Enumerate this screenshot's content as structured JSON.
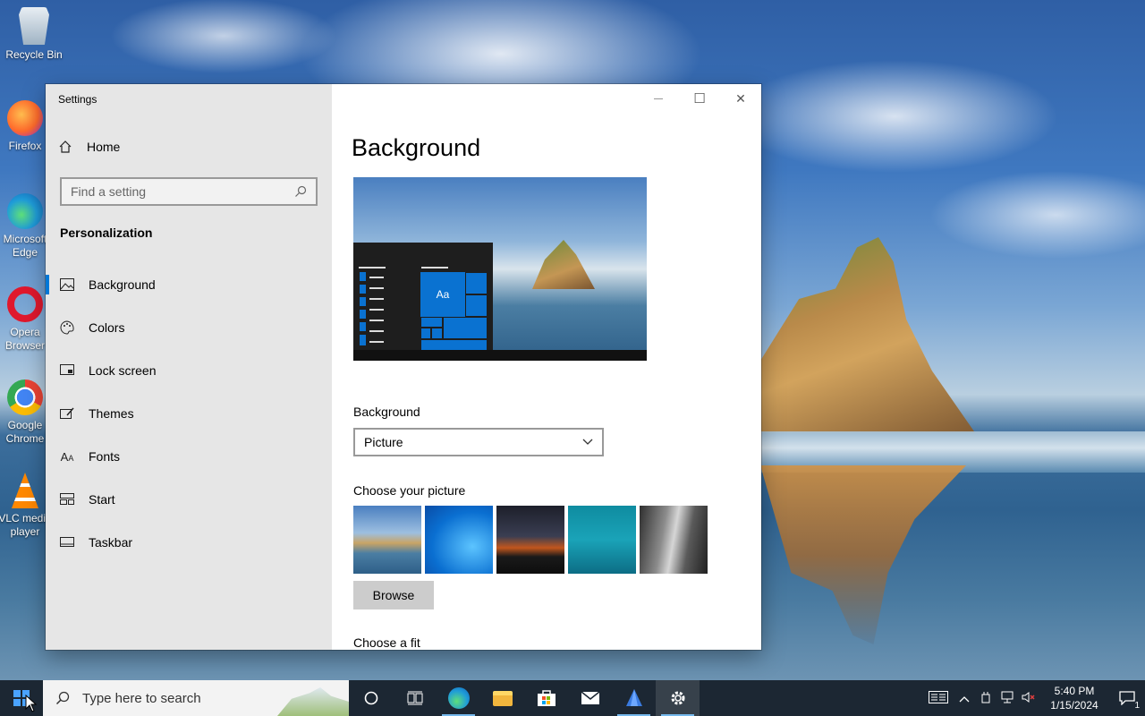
{
  "desktop": {
    "icons": [
      {
        "label": "Recycle Bin"
      },
      {
        "label": "Firefox"
      },
      {
        "label": "Microsoft Edge"
      },
      {
        "label": "Opera Browser"
      },
      {
        "label": "Google Chrome"
      },
      {
        "label": "VLC media player"
      }
    ]
  },
  "window": {
    "title": "Settings",
    "minimize_glyph": "—",
    "maximize_glyph": "☐",
    "close_glyph": "✕"
  },
  "sidebar": {
    "home_label": "Home",
    "search_placeholder": "Find a setting",
    "section_title": "Personalization",
    "items": [
      {
        "label": "Background",
        "icon": "picture-icon",
        "selected": true
      },
      {
        "label": "Colors",
        "icon": "palette-icon",
        "selected": false
      },
      {
        "label": "Lock screen",
        "icon": "lock-screen-icon",
        "selected": false
      },
      {
        "label": "Themes",
        "icon": "themes-icon",
        "selected": false
      },
      {
        "label": "Fonts",
        "icon": "fonts-icon",
        "selected": false
      },
      {
        "label": "Start",
        "icon": "start-icon",
        "selected": false
      },
      {
        "label": "Taskbar",
        "icon": "taskbar-icon",
        "selected": false
      }
    ]
  },
  "content": {
    "page_title": "Background",
    "preview_tile_label": "Aa",
    "background_label": "Background",
    "background_value": "Picture",
    "choose_picture_label": "Choose your picture",
    "browse_label": "Browse",
    "choose_fit_label": "Choose a fit"
  },
  "taskbar": {
    "search_placeholder": "Type here to search",
    "apps": [
      "cortana-icon",
      "task-view-icon",
      "edge-icon",
      "file-explorer-icon",
      "store-icon",
      "mail-icon",
      "app-icon",
      "settings-icon"
    ],
    "time": "5:40 PM",
    "date": "1/15/2024",
    "notification_count": "1"
  },
  "colors": {
    "accent": "#0078d7",
    "sidebar_bg": "#e6e6e6",
    "taskbar_bg": "#1c2733"
  }
}
